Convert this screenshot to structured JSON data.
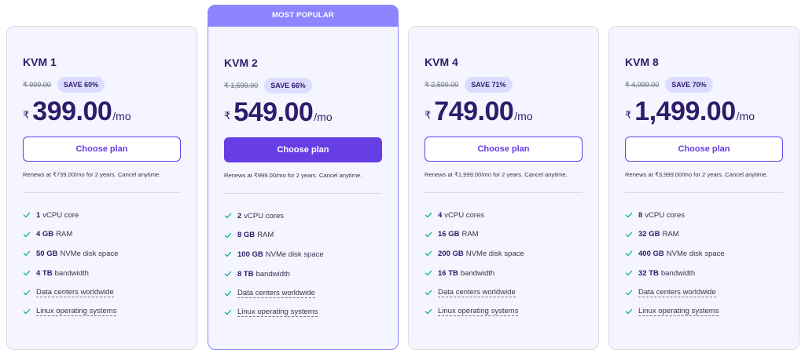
{
  "colors": {
    "accent": "#673de6",
    "popular_banner": "#8c85ff",
    "card_bg": "#f4f5ff",
    "check": "#00b090",
    "badge_bg": "#dcdcff"
  },
  "plans": [
    {
      "name": "KVM 1",
      "old_price": "₹ 999.00",
      "save": "SAVE 60%",
      "currency": "₹",
      "price": "399.00",
      "per": "/mo",
      "button": "Choose plan",
      "renews": "Renews at ₹739.00/mo for 2 years. Cancel anytime.",
      "features": [
        {
          "bold": "1",
          "text": "vCPU core"
        },
        {
          "bold": "4 GB",
          "text": "RAM"
        },
        {
          "bold": "50 GB",
          "text": "NVMe disk space"
        },
        {
          "bold": "4 TB",
          "text": "bandwidth"
        },
        {
          "bold": "",
          "text": "Data centers worldwide"
        },
        {
          "bold": "",
          "text": "Linux operating systems"
        }
      ]
    },
    {
      "name": "KVM 2",
      "badge": "MOST POPULAR",
      "old_price": "₹ 1,599.00",
      "save": "SAVE 66%",
      "currency": "₹",
      "price": "549.00",
      "per": "/mo",
      "button": "Choose plan",
      "renews": "Renews at ₹999.00/mo for 2 years. Cancel anytime.",
      "features": [
        {
          "bold": "2",
          "text": "vCPU cores"
        },
        {
          "bold": "8 GB",
          "text": "RAM"
        },
        {
          "bold": "100 GB",
          "text": "NVMe disk space"
        },
        {
          "bold": "8 TB",
          "text": "bandwidth"
        },
        {
          "bold": "",
          "text": "Data centers worldwide"
        },
        {
          "bold": "",
          "text": "Linux operating systems"
        }
      ]
    },
    {
      "name": "KVM 4",
      "old_price": "₹ 2,599.00",
      "save": "SAVE 71%",
      "currency": "₹",
      "price": "749.00",
      "per": "/mo",
      "button": "Choose plan",
      "renews": "Renews at ₹1,999.00/mo for 2 years. Cancel anytime.",
      "features": [
        {
          "bold": "4",
          "text": "vCPU cores"
        },
        {
          "bold": "16 GB",
          "text": "RAM"
        },
        {
          "bold": "200 GB",
          "text": "NVMe disk space"
        },
        {
          "bold": "16 TB",
          "text": "bandwidth"
        },
        {
          "bold": "",
          "text": "Data centers worldwide"
        },
        {
          "bold": "",
          "text": "Linux operating systems"
        }
      ]
    },
    {
      "name": "KVM 8",
      "old_price": "₹ 4,999.00",
      "save": "SAVE 70%",
      "currency": "₹",
      "price": "1,499.00",
      "per": "/mo",
      "button": "Choose plan",
      "renews": "Renews at ₹3,999.00/mo for 2 years. Cancel anytime.",
      "features": [
        {
          "bold": "8",
          "text": "vCPU cores"
        },
        {
          "bold": "32 GB",
          "text": "RAM"
        },
        {
          "bold": "400 GB",
          "text": "NVMe disk space"
        },
        {
          "bold": "32 TB",
          "text": "bandwidth"
        },
        {
          "bold": "",
          "text": "Data centers worldwide"
        },
        {
          "bold": "",
          "text": "Linux operating systems"
        }
      ]
    }
  ]
}
